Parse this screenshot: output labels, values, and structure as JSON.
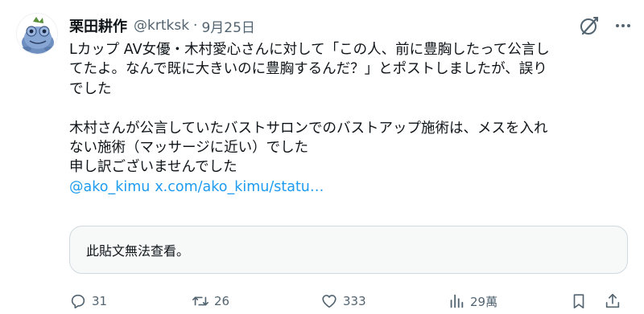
{
  "author": {
    "display_name": "栗田耕作",
    "handle": "@krtksk",
    "separator": "·",
    "date": "9月25日"
  },
  "body": {
    "lines": [
      "Lカップ AV女優・木村愛心さんに対して「この人、前に豊胸したって公言し",
      "てたよ。なんで既に大きいのに豊胸するんだ？」とポストしましたが、誤り",
      "でした",
      "",
      "木村さんが公言していたバストサロンでのバストアップ施術は、メスを入れ",
      "ない施術（マッサージに近い）でした",
      "申し訳ございませんでした"
    ],
    "links": [
      "@ako_kimu",
      "x.com/ako_kimu/statu…"
    ]
  },
  "quote_unavailable": {
    "text": "此貼文無法查看。"
  },
  "actions": {
    "replies": "31",
    "retweets": "26",
    "likes": "333",
    "views": "29萬"
  },
  "icons": {
    "avatar": "frog-character-avatar",
    "grok": "grok-icon",
    "more": "more-dots-icon",
    "reply": "reply-icon",
    "retweet": "retweet-icon",
    "like": "heart-icon",
    "views": "views-chart-icon",
    "bookmark": "bookmark-icon",
    "share": "share-icon"
  },
  "colors": {
    "text": "#0f1419",
    "secondary": "#536471",
    "link": "#1d9bf0",
    "card_border": "#cfd9de",
    "card_bg": "#f7f9f9"
  }
}
